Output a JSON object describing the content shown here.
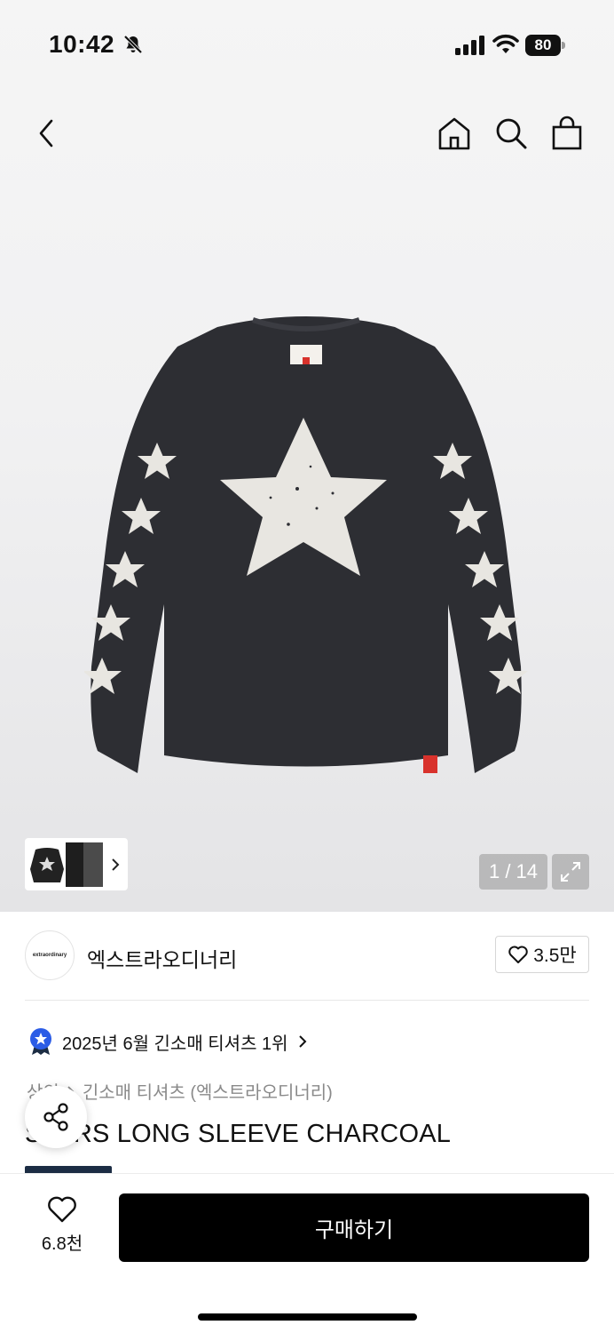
{
  "status_bar": {
    "time": "10:42",
    "battery_level": "80",
    "icons": [
      "bell-slash-icon",
      "signal-icon",
      "wifi-icon",
      "battery-icon"
    ]
  },
  "nav": {
    "icons": [
      "back-arrow-icon",
      "home-icon",
      "search-icon",
      "shopping-bag-icon"
    ]
  },
  "gallery": {
    "counter": "1 / 14",
    "expand_icon": "expand-icon",
    "thumbnail_arrow": "chevron-right-icon"
  },
  "brand": {
    "name": "엑스트라오디너리",
    "logo_text": "extraordinary",
    "likes": "3.5만"
  },
  "ranking": {
    "text": "2025년 6월 긴소매 티셔츠 1위",
    "badge_color": "#2b5ce6"
  },
  "breadcrumb": {
    "items": [
      "상의",
      "긴소매 티셔츠 (엑스트라오디너리)"
    ]
  },
  "product": {
    "title": "STARS LONG SLEEVE CHARCOAL",
    "color_name": "charcoal",
    "garment_color": "#2d2e33"
  },
  "bottom_bar": {
    "wish_count": "6.8천",
    "buy_label": "구매하기"
  }
}
